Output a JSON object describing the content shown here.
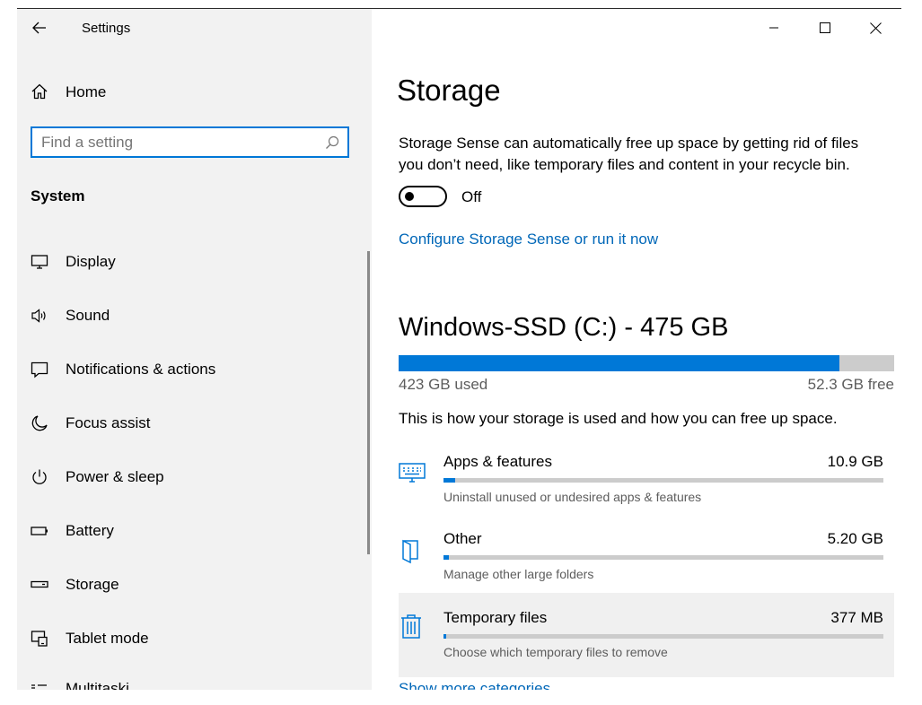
{
  "window": {
    "app_title": "Settings",
    "controls": {
      "minimize": "minimize-icon",
      "maximize": "maximize-icon",
      "close": "close-icon"
    }
  },
  "sidebar": {
    "home_label": "Home",
    "search_placeholder": "Find a setting",
    "section_title": "System",
    "items": [
      {
        "label": "Display",
        "icon": "display-icon"
      },
      {
        "label": "Sound",
        "icon": "sound-icon"
      },
      {
        "label": "Notifications & actions",
        "icon": "notifications-icon"
      },
      {
        "label": "Focus assist",
        "icon": "moon-icon"
      },
      {
        "label": "Power & sleep",
        "icon": "power-icon"
      },
      {
        "label": "Battery",
        "icon": "battery-icon"
      },
      {
        "label": "Storage",
        "icon": "storage-icon"
      },
      {
        "label": "Tablet mode",
        "icon": "tablet-mode-icon"
      }
    ],
    "partial_item_label": "Multitaski"
  },
  "storage": {
    "title": "Storage",
    "sense_description": "Storage Sense can automatically free up space by getting rid of files you don’t need, like temporary files and content in your recycle bin.",
    "sense_toggle_state": "Off",
    "configure_link": "Configure Storage Sense or run it now",
    "drive_title": "Windows-SSD (C:) - 475 GB",
    "used_label": "423 GB used",
    "free_label": "52.3 GB free",
    "used_fraction": 0.89,
    "usage_description": "This is how your storage is used and how you can free up space.",
    "categories": [
      {
        "name": "Apps & features",
        "size": "10.9 GB",
        "subtitle": "Uninstall unused or undesired apps & features",
        "fraction": 0.026,
        "icon": "apps-features-icon"
      },
      {
        "name": "Other",
        "size": "5.20 GB",
        "subtitle": "Manage other large folders",
        "fraction": 0.012,
        "icon": "other-folder-icon"
      },
      {
        "name": "Temporary files",
        "size": "377 MB",
        "subtitle": "Choose which temporary files to remove",
        "fraction": 0.001,
        "icon": "trash-icon"
      }
    ],
    "partial_link": "Show more categories"
  },
  "colors": {
    "accent": "#0078d7",
    "link": "#0067b8",
    "sidebar_bg": "#f2f2f2",
    "bar_bg": "#cccccc",
    "muted_text": "#5d5d5d"
  }
}
